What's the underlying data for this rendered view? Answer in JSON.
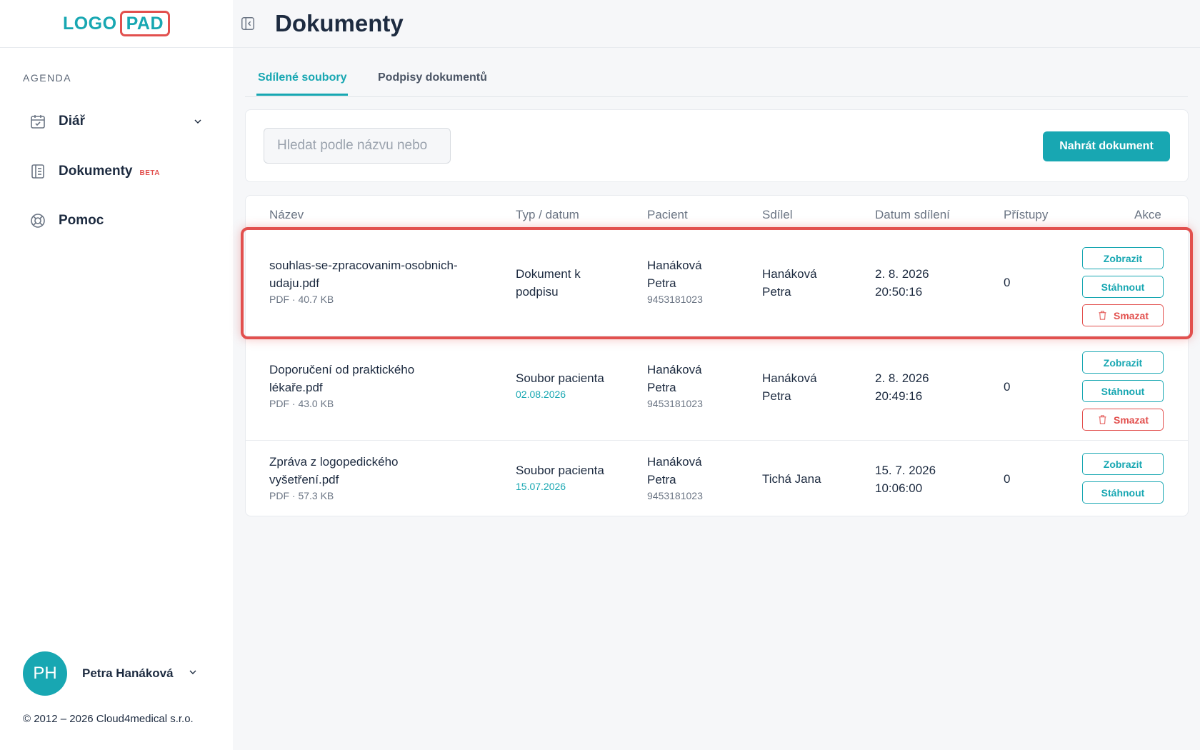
{
  "logo": {
    "part1": "LOGO",
    "part2": "PAD"
  },
  "sidebar": {
    "section_label": "AGENDA",
    "items": [
      {
        "label": "Diář",
        "icon": "calendar-icon"
      },
      {
        "label": "Dokumenty",
        "badge": "BETA",
        "icon": "document-icon"
      },
      {
        "label": "Pomoc",
        "icon": "lifebuoy-icon"
      }
    ],
    "user": {
      "initials": "PH",
      "name": "Petra Hanáková"
    },
    "copyright": "© 2012 – 2026 Cloud4medical s.r.o."
  },
  "header": {
    "title": "Dokumenty"
  },
  "tabs": [
    {
      "label": "Sdílené soubory",
      "active": true
    },
    {
      "label": "Podpisy dokumentů",
      "active": false
    }
  ],
  "search": {
    "placeholder": "Hledat podle názvu nebo"
  },
  "upload_label": "Nahrát dokument",
  "table": {
    "columns": [
      "Název",
      "Typ / datum",
      "Pacient",
      "Sdílel",
      "Datum sdílení",
      "Přístupy",
      "Akce"
    ],
    "rows": [
      {
        "name_line1": "souhlas-se-zpracovanim-osobnich-",
        "name_line2": "udaju.pdf",
        "meta": "PDF · 40.7 KB",
        "type_line1": "Dokument k",
        "type_line2": "podpisu",
        "type_date": "",
        "patient_line1": "Hanáková",
        "patient_line2": "Petra",
        "patient_id": "9453181023",
        "shared_line1": "Hanáková",
        "shared_line2": "Petra",
        "date": "2. 8. 2026",
        "time": "20:50:16",
        "access": "0",
        "actions": [
          "Zobrazit",
          "Stáhnout",
          "Smazat"
        ]
      },
      {
        "name_line1": "Doporučení od praktického",
        "name_line2": "lékaře.pdf",
        "meta": "PDF · 43.0 KB",
        "type_line1": "Soubor pacienta",
        "type_line2": "",
        "type_date": "02.08.2026",
        "patient_line1": "Hanáková",
        "patient_line2": "Petra",
        "patient_id": "9453181023",
        "shared_line1": "Hanáková",
        "shared_line2": "Petra",
        "date": "2. 8. 2026",
        "time": "20:49:16",
        "access": "0",
        "actions": [
          "Zobrazit",
          "Stáhnout",
          "Smazat"
        ]
      },
      {
        "name_line1": "Zpráva z logopedického",
        "name_line2": "vyšetření.pdf",
        "meta": "PDF · 57.3 KB",
        "type_line1": "Soubor pacienta",
        "type_line2": "",
        "type_date": "15.07.2026",
        "patient_line1": "Hanáková",
        "patient_line2": "Petra",
        "patient_id": "9453181023",
        "shared_line1": "Tichá Jana",
        "shared_line2": "",
        "date": "15. 7. 2026",
        "time": "10:06:00",
        "access": "0",
        "actions": [
          "Zobrazit",
          "Stáhnout"
        ]
      }
    ]
  },
  "colors": {
    "accent": "#18a7b2",
    "danger": "#e2504e",
    "text": "#1d2b40"
  }
}
